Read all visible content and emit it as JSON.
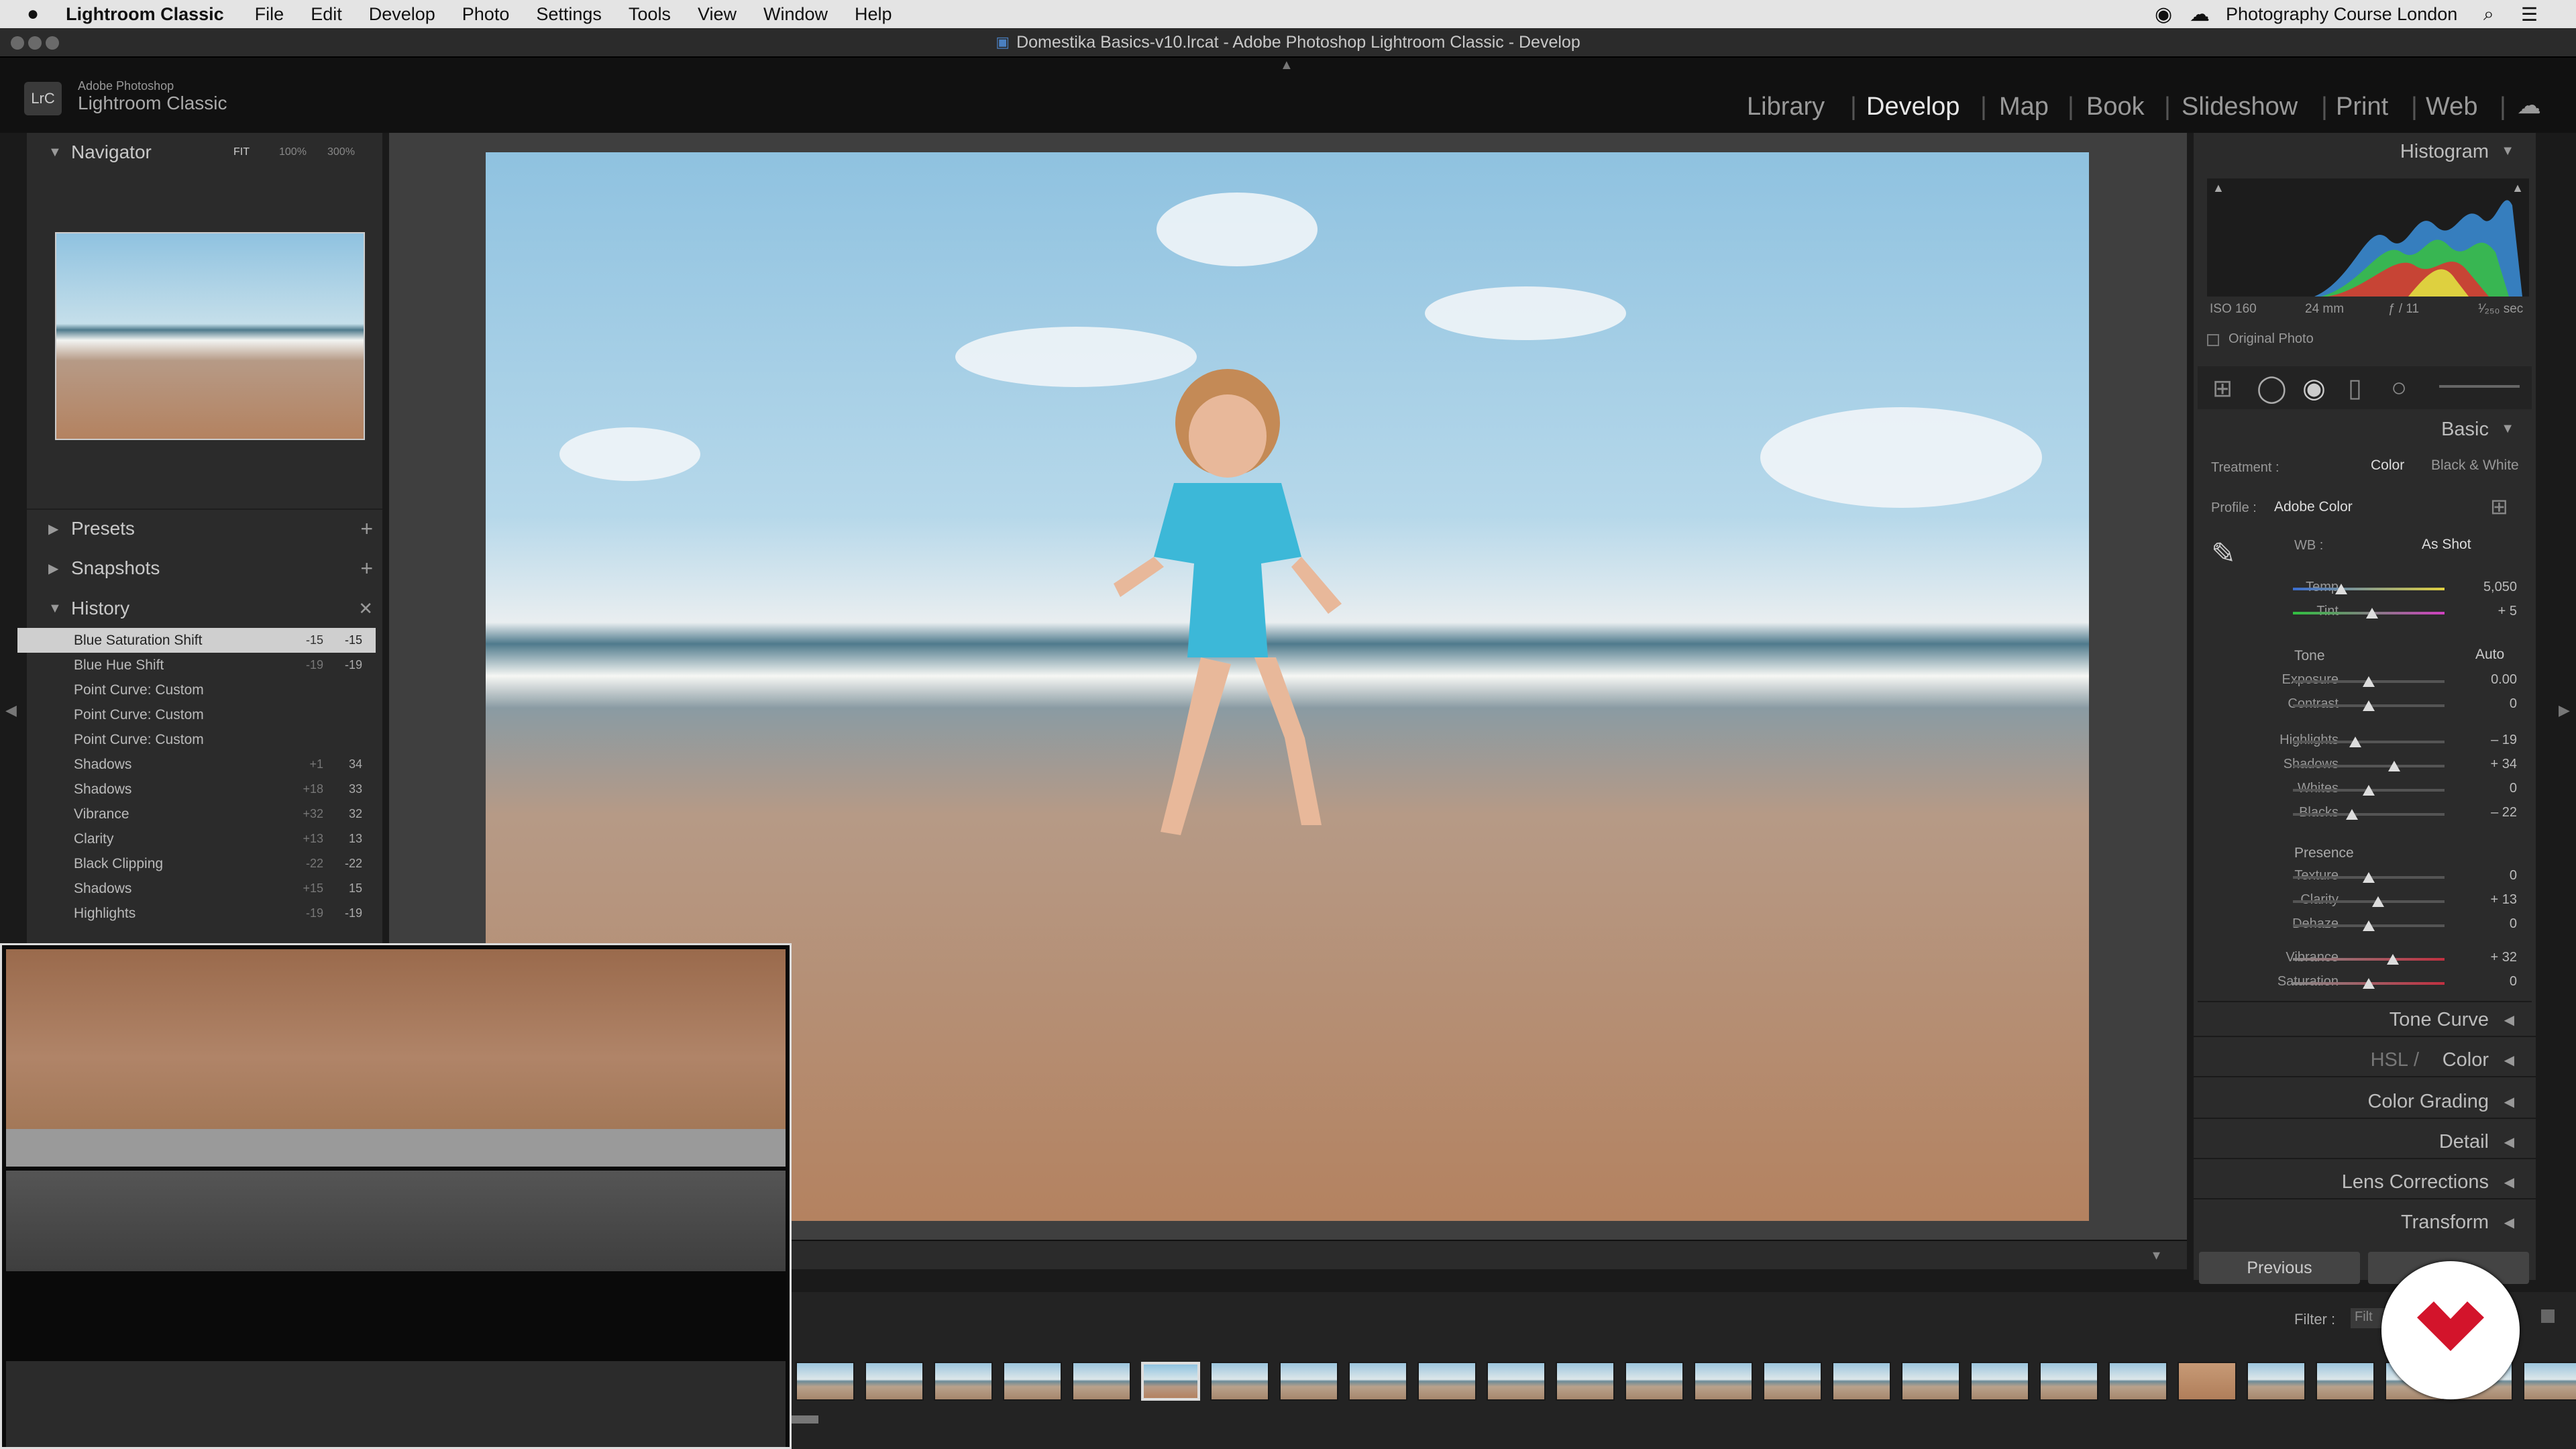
{
  "menubar": {
    "app": "Lightroom Classic",
    "items": [
      "File",
      "Edit",
      "Develop",
      "Photo",
      "Settings",
      "Tools",
      "View",
      "Window",
      "Help"
    ],
    "right_label": "Photography Course London"
  },
  "window": {
    "title": "Domestika Basics-v10.lrcat - Adobe Photoshop Lightroom Classic - Develop"
  },
  "identity": {
    "brand_small": "Adobe Photoshop",
    "brand": "Lightroom Classic",
    "badge": "LrC"
  },
  "modules": [
    "Library",
    "Develop",
    "Map",
    "Book",
    "Slideshow",
    "Print",
    "Web"
  ],
  "active_module": "Develop",
  "navigator": {
    "title": "Navigator",
    "zoom": [
      "FIT",
      "100%",
      "300%"
    ]
  },
  "left_panels": {
    "presets": "Presets",
    "snapshots": "Snapshots",
    "history": "History"
  },
  "history": [
    {
      "label": "Blue Saturation Shift",
      "v1": "-15",
      "v2": "-15"
    },
    {
      "label": "Blue Hue Shift",
      "v1": "-19",
      "v2": "-19"
    },
    {
      "label": "Point Curve: Custom",
      "v1": "",
      "v2": ""
    },
    {
      "label": "Point Curve: Custom",
      "v1": "",
      "v2": ""
    },
    {
      "label": "Point Curve: Custom",
      "v1": "",
      "v2": ""
    },
    {
      "label": "Shadows",
      "v1": "+1",
      "v2": "34"
    },
    {
      "label": "Shadows",
      "v1": "+18",
      "v2": "33"
    },
    {
      "label": "Vibrance",
      "v1": "+32",
      "v2": "32"
    },
    {
      "label": "Clarity",
      "v1": "+13",
      "v2": "13"
    },
    {
      "label": "Black Clipping",
      "v1": "-22",
      "v2": "-22"
    },
    {
      "label": "Shadows",
      "v1": "+15",
      "v2": "15"
    },
    {
      "label": "Highlights",
      "v1": "-19",
      "v2": "-19"
    }
  ],
  "histogram": {
    "title": "Histogram",
    "iso": "ISO 160",
    "focal": "24 mm",
    "aperture": "ƒ / 11",
    "shutter": "¹⁄₂₅₀ sec",
    "original": "Original Photo"
  },
  "basic": {
    "title": "Basic",
    "treatment_label": "Treatment :",
    "color": "Color",
    "bw": "Black & White",
    "profile_label": "Profile :",
    "profile": "Adobe Color",
    "wb_label": "WB :",
    "wb": "As Shot",
    "tone": "Tone",
    "auto": "Auto",
    "presence": "Presence"
  },
  "sliders": [
    {
      "label": "Temp",
      "value": "5,050",
      "pos": 0.32
    },
    {
      "label": "Tint",
      "value": "+ 5",
      "pos": 0.52
    },
    {
      "label": "Exposure",
      "value": "0.00",
      "pos": 0.5
    },
    {
      "label": "Contrast",
      "value": "0",
      "pos": 0.5
    },
    {
      "label": "Highlights",
      "value": "– 19",
      "pos": 0.41
    },
    {
      "label": "Shadows",
      "value": "+ 34",
      "pos": 0.67
    },
    {
      "label": "Whites",
      "value": "0",
      "pos": 0.5
    },
    {
      "label": "Blacks",
      "value": "– 22",
      "pos": 0.39
    },
    {
      "label": "Texture",
      "value": "0",
      "pos": 0.5
    },
    {
      "label": "Clarity",
      "value": "+ 13",
      "pos": 0.56
    },
    {
      "label": "Dehaze",
      "value": "0",
      "pos": 0.5
    },
    {
      "label": "Vibrance",
      "value": "+ 32",
      "pos": 0.66
    },
    {
      "label": "Saturation",
      "value": "0",
      "pos": 0.5
    }
  ],
  "right_panels": {
    "tone_curve": "Tone Curve",
    "hsl1": "HSL",
    "hsl2": "Color",
    "color_grading": "Color Grading",
    "detail": "Detail",
    "lens": "Lens Corrections",
    "transform": "Transform"
  },
  "buttons": {
    "previous": "Previous"
  },
  "filter": {
    "label": "Filter :",
    "value": "Filt"
  }
}
